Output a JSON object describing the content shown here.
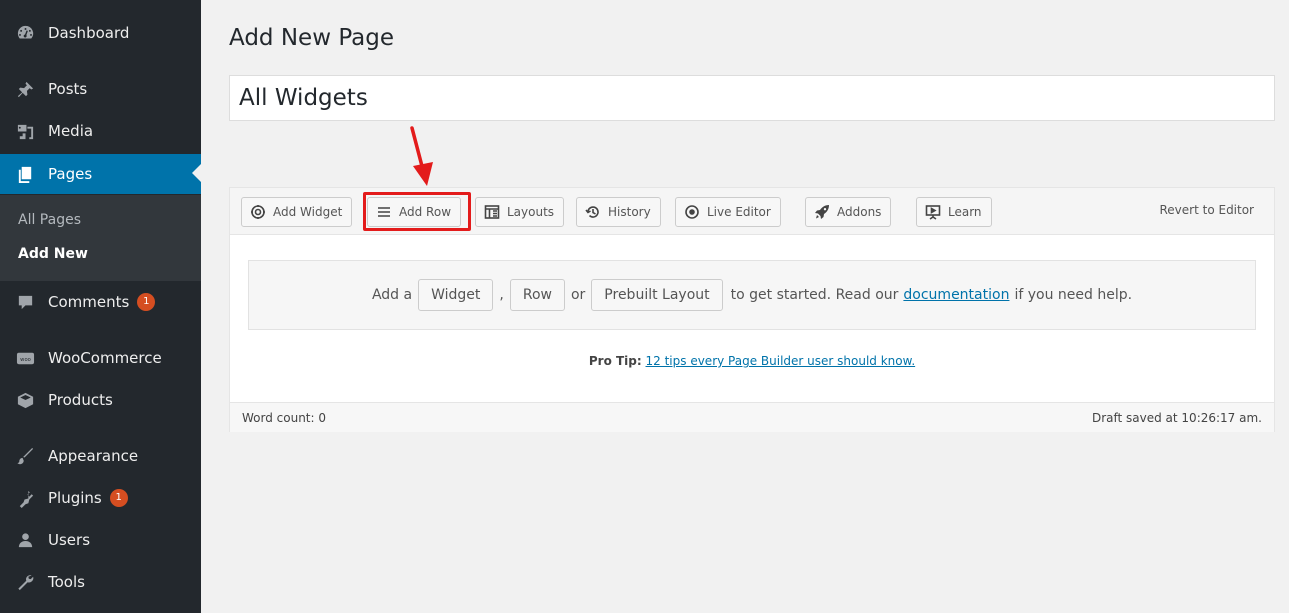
{
  "sidebar": {
    "items": [
      {
        "label": "Dashboard",
        "icon": "dashboard-icon"
      },
      {
        "label": "Posts",
        "icon": "pushpin-icon"
      },
      {
        "label": "Media",
        "icon": "media-icon"
      },
      {
        "label": "Pages",
        "icon": "pages-icon",
        "active": true
      },
      {
        "label": "Comments",
        "icon": "comment-icon",
        "badge": "1"
      },
      {
        "label": "WooCommerce",
        "icon": "woocommerce-icon"
      },
      {
        "label": "Products",
        "icon": "products-icon"
      },
      {
        "label": "Appearance",
        "icon": "appearance-brush-icon"
      },
      {
        "label": "Plugins",
        "icon": "plugin-icon",
        "badge": "1"
      },
      {
        "label": "Users",
        "icon": "users-icon"
      },
      {
        "label": "Tools",
        "icon": "wrench-icon"
      }
    ],
    "submenu": [
      {
        "label": "All Pages"
      },
      {
        "label": "Add New",
        "current": true
      }
    ]
  },
  "main": {
    "heading": "Add New Page",
    "title_value": "All Widgets"
  },
  "builder": {
    "toolbar": [
      {
        "label": "Add Widget",
        "icon": "widget-gear-icon"
      },
      {
        "label": "Add Row",
        "icon": "rows-icon",
        "highlighted": true
      },
      {
        "label": "Layouts",
        "icon": "layouts-icon"
      },
      {
        "label": "History",
        "icon": "history-icon"
      },
      {
        "label": "Live Editor",
        "icon": "eye-icon"
      },
      {
        "label": "Addons",
        "icon": "rocket-icon"
      },
      {
        "label": "Learn",
        "icon": "learn-presentation-icon"
      }
    ],
    "revert_label": "Revert to Editor",
    "empty": {
      "prefix": "Add a",
      "widget_btn": "Widget",
      "comma": ",",
      "row_btn": "Row",
      "or": "or",
      "layout_btn": "Prebuilt Layout",
      "suffix": "to get started. Read our",
      "doc_link": "documentation",
      "end": "if you need help."
    },
    "protip_label": "Pro Tip:",
    "protip_link": "12 tips every Page Builder user should know."
  },
  "status": {
    "word_count": "Word count: 0",
    "draft_saved": "Draft saved at 10:26:17 am."
  },
  "colors": {
    "sidebar_bg": "#23282d",
    "active_bg": "#0073aa",
    "badge": "#d54e21",
    "highlight_red": "#e31b1b",
    "link": "#0073aa"
  }
}
